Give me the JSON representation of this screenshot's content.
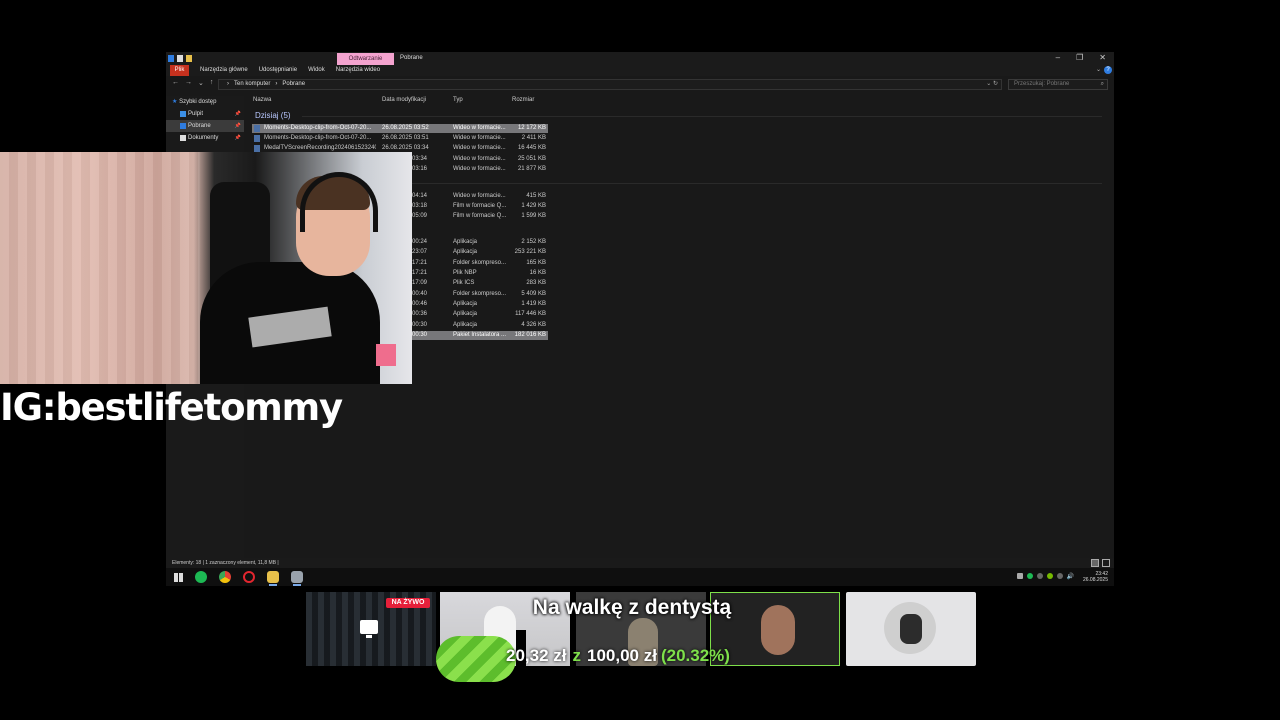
{
  "explorer": {
    "window_title": "Pobrane",
    "context_tab": "Odtwarzanie",
    "ribbon": {
      "file_tab": "Plik",
      "tabs": [
        "Narzędzia główne",
        "Udostępnianie",
        "Widok",
        "Narzędzia wideo"
      ]
    },
    "breadcrumb": [
      "Ten komputer",
      "Pobrane"
    ],
    "search_placeholder": "Przeszukaj: Pobrane",
    "navigation": [
      {
        "label": "Szybki dostęp",
        "icon": "star-icon"
      },
      {
        "label": "Pulpit",
        "icon": "desktop-icon"
      },
      {
        "label": "Pobrane",
        "icon": "download-icon"
      },
      {
        "label": "Dokumenty",
        "icon": "document-icon"
      }
    ],
    "columns": [
      "Nazwa",
      "Data modyfikacji",
      "Typ",
      "Rozmiar"
    ],
    "group_header": "Dzisiaj (5)",
    "files_today": [
      {
        "name": "Moments-Desktop-clip-from-Oct-07-20...",
        "date": "26.08.2025 03:52",
        "type": "Wideo w formacie...",
        "size": "12 172 KB",
        "selected": true
      },
      {
        "name": "Moments-Desktop-clip-from-Oct-07-20...",
        "date": "26.08.2025 03:51",
        "type": "Wideo w formacie...",
        "size": "2 411 KB"
      },
      {
        "name": "MedalTVScreenRecording2024061523240...",
        "date": "26.08.2025 03:34",
        "type": "Wideo w formacie...",
        "size": "16 445 KB"
      },
      {
        "name": "",
        "date": "03:34",
        "type": "Wideo w formacie...",
        "size": "25 051 KB"
      },
      {
        "name": "",
        "date": "03:16",
        "type": "Wideo w formacie...",
        "size": "21 877 KB"
      }
    ],
    "files_earlier": [
      {
        "date": "04:14",
        "type": "Wideo w formacie...",
        "size": "415 KB"
      },
      {
        "date": "03:18",
        "type": "Film w formacie Q...",
        "size": "1 429 KB"
      },
      {
        "date": "05:09",
        "type": "Film w formacie Q...",
        "size": "1 599 KB"
      }
    ],
    "files_older": [
      {
        "date": "00:24",
        "type": "Aplikacja",
        "size": "2 152 KB"
      },
      {
        "date": "23:07",
        "type": "Aplikacja",
        "size": "253 221 KB"
      },
      {
        "date": "17:21",
        "type": "Folder skompreso...",
        "size": "165 KB"
      },
      {
        "date": "17:21",
        "type": "Plik NBP",
        "size": "16 KB"
      },
      {
        "date": "17:09",
        "type": "Plik ICS",
        "size": "283 KB"
      },
      {
        "date": "00:40",
        "type": "Folder skompreso...",
        "size": "5 409 KB"
      },
      {
        "date": "00:46",
        "type": "Aplikacja",
        "size": "1 419 KB"
      },
      {
        "date": "00:36",
        "type": "Aplikacja",
        "size": "117 446 KB"
      },
      {
        "date": "00:30",
        "type": "Aplikacja",
        "size": "4 326 KB"
      },
      {
        "date": "00:30",
        "type": "Pakiet Instalatora ...",
        "size": "182 016 KB",
        "selected": true
      }
    ],
    "status": "Elementy: 18  |  1 zaznaczony element, 11,8 MB  |"
  },
  "taskbar": {
    "apps": [
      "windows-start-icon",
      "spotify-icon",
      "chrome-icon",
      "opera-icon",
      "file-explorer-icon",
      "app-icon"
    ],
    "time": "23:42",
    "date": "26.08.2025"
  },
  "overlay": {
    "ig_handle": "IG:bestlifetommy",
    "live_badge": "NA ŻYWO",
    "goal_title": "Na walkę z dentystą",
    "goal_current": "20,32 zł",
    "goal_sep": "z",
    "goal_target": "100,00 zł",
    "goal_percent": "(20.32%)",
    "goal_progress": 0.2032,
    "accent_color": "#7ee04a"
  }
}
